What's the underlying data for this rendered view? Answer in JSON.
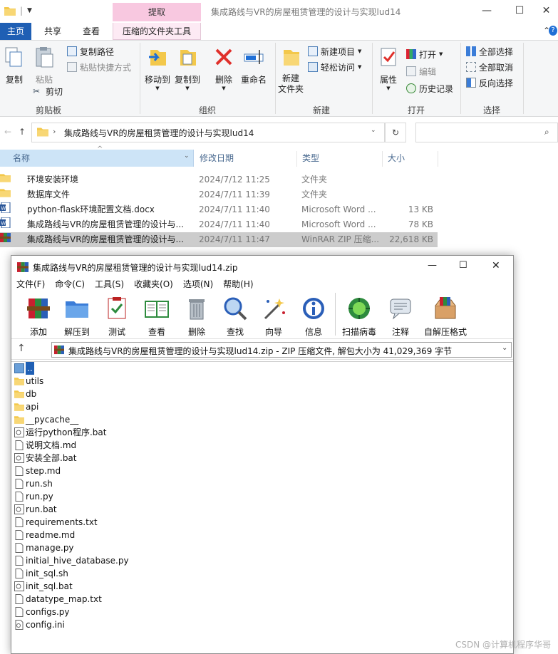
{
  "titlebar": {
    "context_tab": "提取",
    "window_title": "集成路线与VR的房屋租赁管理的设计与实现lud14",
    "minimize": "—",
    "maximize": "☐",
    "close": "✕"
  },
  "ribbon_tabs": [
    "主页",
    "共享",
    "查看",
    "压缩的文件夹工具"
  ],
  "ribbon": {
    "clipboard": {
      "copy": "复制",
      "paste": "粘贴",
      "copy_path": "复制路径",
      "paste_shortcut": "粘贴快捷方式",
      "cut": "剪切",
      "label": "剪贴板"
    },
    "organize": {
      "move_to": "移动到",
      "copy_to": "复制到",
      "delete": "删除",
      "rename": "重命名",
      "label": "组织"
    },
    "new": {
      "new_folder": "新建\n文件夹",
      "new_item": "新建项目",
      "easy_access": "轻松访问",
      "label": "新建"
    },
    "open": {
      "properties": "属性",
      "open": "打开",
      "edit": "编辑",
      "history": "历史记录",
      "label": "打开"
    },
    "select": {
      "select_all": "全部选择",
      "select_none": "全部取消",
      "invert": "反向选择",
      "label": "选择"
    }
  },
  "address": {
    "path": "集成路线与VR的房屋租赁管理的设计与实现lud14",
    "refresh": "↻"
  },
  "list_header": {
    "name": "名称",
    "date": "修改日期",
    "type": "类型",
    "size": "大小"
  },
  "files": [
    {
      "name": "环境安装环境",
      "date": "2024/7/12 11:25",
      "type": "文件夹",
      "size": "",
      "icon": "folder"
    },
    {
      "name": "数据库文件",
      "date": "2024/7/11 11:39",
      "type": "文件夹",
      "size": "",
      "icon": "folder"
    },
    {
      "name": "python-flask环境配置文档.docx",
      "date": "2024/7/11 11:40",
      "type": "Microsoft Word ...",
      "size": "13 KB",
      "icon": "word"
    },
    {
      "name": "集成路线与VR的房屋租赁管理的设计与...",
      "date": "2024/7/11 11:40",
      "type": "Microsoft Word ...",
      "size": "78 KB",
      "icon": "word"
    },
    {
      "name": "集成路线与VR的房屋租赁管理的设计与...",
      "date": "2024/7/11 11:47",
      "type": "WinRAR ZIP 压缩...",
      "size": "22,618 KB",
      "icon": "rar"
    }
  ],
  "rar": {
    "title": "集成路线与VR的房屋租赁管理的设计与实现lud14.zip",
    "menu": [
      "文件(F)",
      "命令(C)",
      "工具(S)",
      "收藏夹(O)",
      "选项(N)",
      "帮助(H)"
    ],
    "tools": [
      "添加",
      "解压到",
      "测试",
      "查看",
      "删除",
      "查找",
      "向导",
      "信息",
      "扫描病毒",
      "注释",
      "自解压格式"
    ],
    "path_text": "集成路线与VR的房屋租赁管理的设计与实现lud14.zip - ZIP 压缩文件, 解包大小为 41,029,369 字节",
    "items": [
      {
        "name": "..",
        "icon": "up"
      },
      {
        "name": "utils",
        "icon": "folder"
      },
      {
        "name": "db",
        "icon": "folder"
      },
      {
        "name": "api",
        "icon": "folder"
      },
      {
        "name": "__pycache__",
        "icon": "folder"
      },
      {
        "name": "运行python程序.bat",
        "icon": "bat"
      },
      {
        "name": "说明文档.md",
        "icon": "doc"
      },
      {
        "name": "安装全部.bat",
        "icon": "bat"
      },
      {
        "name": "step.md",
        "icon": "doc"
      },
      {
        "name": "run.sh",
        "icon": "doc"
      },
      {
        "name": "run.py",
        "icon": "doc"
      },
      {
        "name": "run.bat",
        "icon": "bat"
      },
      {
        "name": "requirements.txt",
        "icon": "doc"
      },
      {
        "name": "readme.md",
        "icon": "doc"
      },
      {
        "name": "manage.py",
        "icon": "doc"
      },
      {
        "name": "initial_hive_database.py",
        "icon": "doc"
      },
      {
        "name": "init_sql.sh",
        "icon": "doc"
      },
      {
        "name": "init_sql.bat",
        "icon": "bat"
      },
      {
        "name": "datatype_map.txt",
        "icon": "doc"
      },
      {
        "name": "configs.py",
        "icon": "doc"
      },
      {
        "name": "config.ini",
        "icon": "ini"
      }
    ]
  },
  "watermark": "CSDN @计算机程序华哥"
}
